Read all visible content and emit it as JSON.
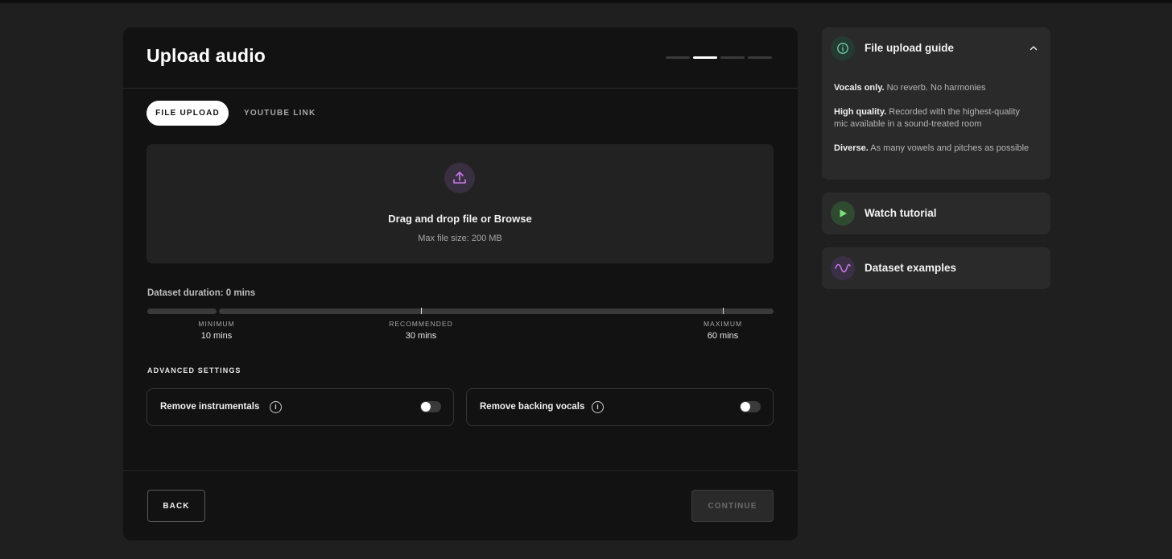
{
  "main": {
    "title": "Upload audio",
    "steps_total": 4,
    "current_step": 2,
    "tabs": [
      {
        "label": "FILE UPLOAD",
        "active": true
      },
      {
        "label": "YOUTUBE LINK",
        "active": false
      }
    ],
    "dropzone": {
      "icon": "upload-icon",
      "title": "Drag and drop file or Browse",
      "subtitle": "Max file size: 200 MB"
    },
    "duration": {
      "label": "Dataset duration: 0 mins",
      "current_mins": 0,
      "max_mins": 60,
      "markers": [
        {
          "caption": "MINIMUM",
          "value": "10 mins",
          "mins": 10
        },
        {
          "caption": "RECOMMENDED",
          "value": "30 mins",
          "mins": 30
        },
        {
          "caption": "MAXIMUM",
          "value": "60 mins",
          "mins": 60
        }
      ]
    },
    "advanced": {
      "label": "ADVANCED SETTINGS",
      "options": [
        {
          "label": "Remove instrumentals",
          "enabled": false
        },
        {
          "label": "Remove backing vocals",
          "enabled": false
        }
      ]
    },
    "footer": {
      "back_label": "BACK",
      "continue_label": "CONTINUE"
    }
  },
  "sidebar": {
    "guide": {
      "title": "File upload guide",
      "expanded": true,
      "items": [
        {
          "bold": "Vocals only.",
          "text": " No reverb. No harmonies"
        },
        {
          "bold": "High quality.",
          "text": " Recorded with the highest-quality mic available in a sound-treated room"
        },
        {
          "bold": "Diverse.",
          "text": " As many vowels and pitches as possible"
        }
      ]
    },
    "tutorial": {
      "title": "Watch tutorial"
    },
    "examples": {
      "title": "Dataset examples"
    }
  },
  "colors": {
    "background": "#1f1f1f",
    "card": "#121212",
    "panel": "#2a2a2a",
    "accent_purple": "#c77be8",
    "accent_green": "#7ee07a",
    "accent_teal": "#6fd3a8"
  }
}
